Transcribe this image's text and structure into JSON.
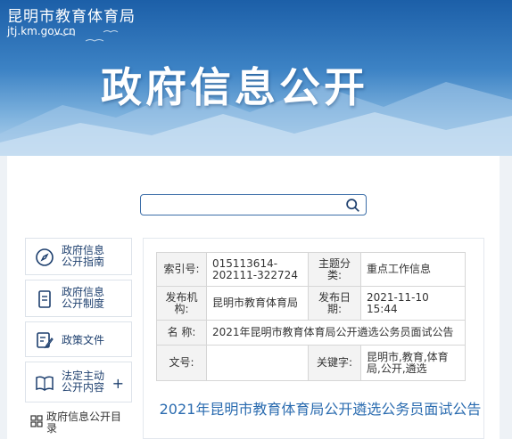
{
  "header": {
    "site_name": "昆明市教育体育局",
    "site_url": "jtj.km.gov.cn",
    "banner_title": "政府信息公开"
  },
  "search": {
    "placeholder": "",
    "value": ""
  },
  "sidebar": {
    "items": [
      {
        "label": "政府信息公开指南",
        "icon": "compass-icon"
      },
      {
        "label": "政府信息公开制度",
        "icon": "document-icon"
      },
      {
        "label": "政策文件",
        "icon": "file-edit-icon"
      },
      {
        "label": "法定主动公开内容",
        "icon": "book-icon",
        "expand": "+"
      },
      {
        "label": "政府信息公开目录",
        "icon": "grid-icon"
      }
    ]
  },
  "info": {
    "index_key": "索引号:",
    "index_val": "015113614-202111-322724",
    "subject_key": "主题分类:",
    "subject_val": "重点工作信息",
    "org_key": "发布机构:",
    "org_val": "昆明市教育体育局",
    "date_key": "发布日期:",
    "date_val": "2021-11-10 15:44",
    "name_key": "名 称:",
    "name_val": "2021年昆明市教育体育局公开遴选公务员面试公告",
    "docno_key": "文号:",
    "docno_val": "",
    "keywords_key": "关键字:",
    "keywords_val": "昆明市,教育,体育局,公开,遴选"
  },
  "document": {
    "title": "2021年昆明市教育体育局公开遴选公务员面试公告"
  },
  "colors": {
    "banner": "#1c5fa8",
    "link": "#2b6cb0",
    "nav_text": "#1d3f6e"
  }
}
